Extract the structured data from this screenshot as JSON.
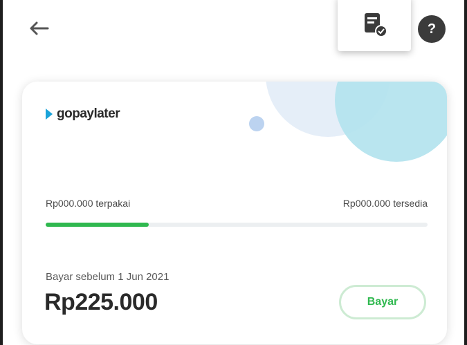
{
  "header": {
    "back_icon": "back-arrow-icon",
    "document_icon": "bill-document-icon",
    "help_icon": "question-mark-icon",
    "help_glyph": "?"
  },
  "card": {
    "brand": "gopaylater",
    "used": "Rp000.000 terpakai",
    "available": "Rp000.000 tersedia",
    "usage_fraction": 0.27,
    "due": "Bayar sebelum 1 Jun 2021",
    "amount": "Rp225.000",
    "pay_label": "Bayar"
  },
  "colors": {
    "accent_green": "#2fb84f",
    "brand_blue": "#1aa3d9",
    "teal_circle": "#b3e3ee",
    "light_circle": "#e5eef8"
  }
}
